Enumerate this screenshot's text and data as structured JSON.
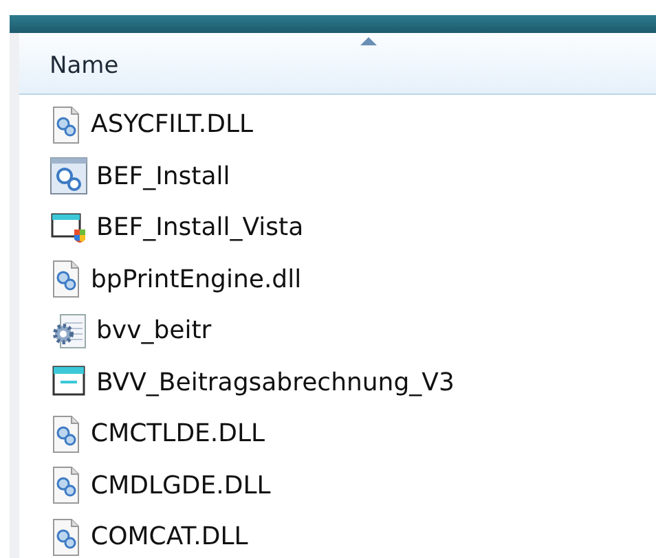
{
  "header": {
    "column": "Name",
    "sorted_ascending": true
  },
  "files": [
    {
      "name": "ASYCFILT.DLL",
      "kind": "dll"
    },
    {
      "name": "BEF_Install",
      "kind": "setup"
    },
    {
      "name": "BEF_Install_Vista",
      "kind": "shortcut"
    },
    {
      "name": "bpPrintEngine.dll",
      "kind": "dll"
    },
    {
      "name": "bvv_beitr",
      "kind": "config"
    },
    {
      "name": "BVV_Beitragsabrechnung_V3",
      "kind": "app"
    },
    {
      "name": "CMCTLDE.DLL",
      "kind": "dll"
    },
    {
      "name": "CMDLGDE.DLL",
      "kind": "dll"
    },
    {
      "name": "COMCAT.DLL",
      "kind": "dll"
    }
  ]
}
